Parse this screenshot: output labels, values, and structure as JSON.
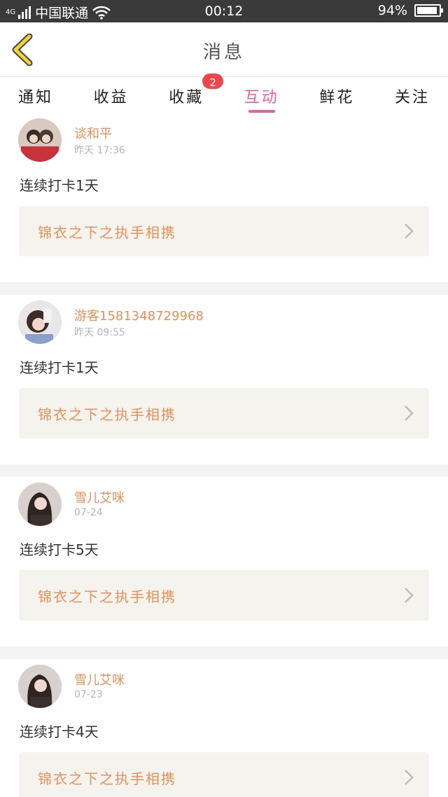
{
  "status_bar": {
    "network_type": "4G",
    "carrier": "中国联通",
    "time": "00:12",
    "battery_percent": "94%",
    "battery_level": 0.94,
    "icons": [
      "signal-icon",
      "wifi-icon",
      "battery-icon"
    ]
  },
  "header": {
    "title": "消息",
    "back_icon": "chevron-left-icon",
    "accent_color": "#f2d23c"
  },
  "tabs": [
    {
      "label": "通知",
      "active": false,
      "badge": ""
    },
    {
      "label": "收益",
      "active": false,
      "badge": ""
    },
    {
      "label": "收藏",
      "active": false,
      "badge": "2"
    },
    {
      "label": "互动",
      "active": true,
      "badge": ""
    },
    {
      "label": "鲜花",
      "active": false,
      "badge": ""
    },
    {
      "label": "关注",
      "active": false,
      "badge": ""
    }
  ],
  "colors": {
    "active_tab": "#e8609a",
    "username": "#e8905a",
    "badge": "#f0454a",
    "book_link_bg": "#f4f3ee"
  },
  "feed": [
    {
      "username": "谈和平",
      "time": "昨天 17:36",
      "message": "连续打卡1天",
      "book_title": "锦衣之下之执手相携"
    },
    {
      "username": "游客1581348729968",
      "time": "昨天 09:55",
      "message": "连续打卡1天",
      "book_title": "锦衣之下之执手相携"
    },
    {
      "username": "雪儿艾咪",
      "time": "07-24",
      "message": "连续打卡5天",
      "book_title": "锦衣之下之执手相携"
    },
    {
      "username": "雪儿艾咪",
      "time": "07-23",
      "message": "连续打卡4天",
      "book_title": "锦衣之下之执手相携"
    }
  ]
}
